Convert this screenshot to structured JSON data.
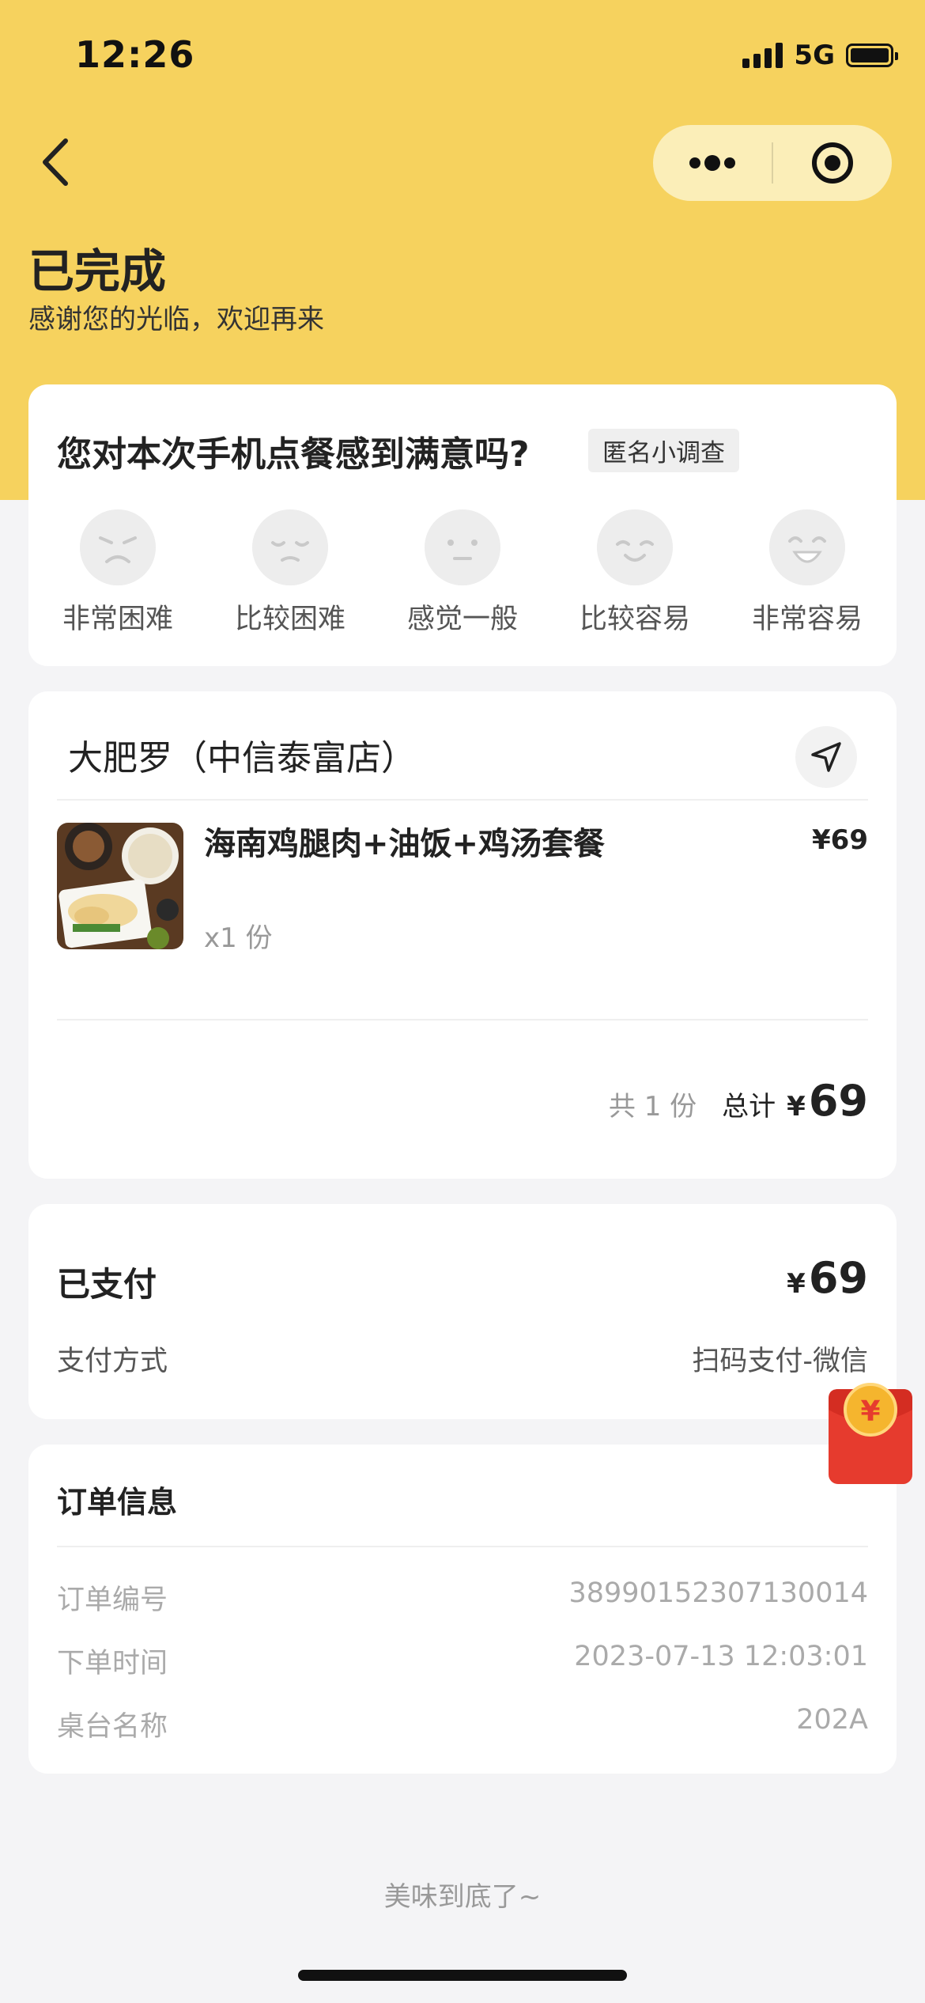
{
  "status_bar": {
    "time": "12:26",
    "network": "5G"
  },
  "header": {
    "title": "已完成",
    "subtitle": "感谢您的光临，欢迎再来"
  },
  "survey": {
    "question": "您对本次手机点餐感到满意吗?",
    "tag": "匿名小调查",
    "options": [
      {
        "label": "非常困难",
        "icon": "very-sad-face-icon"
      },
      {
        "label": "比较困难",
        "icon": "sad-face-icon"
      },
      {
        "label": "感觉一般",
        "icon": "neutral-face-icon"
      },
      {
        "label": "比较容易",
        "icon": "happy-face-icon"
      },
      {
        "label": "非常容易",
        "icon": "very-happy-face-icon"
      }
    ]
  },
  "order": {
    "store_name": "大肥罗（中信泰富店）",
    "item": {
      "name": "海南鸡腿肉+油饭+鸡汤套餐",
      "price": "¥69",
      "quantity": "x1 份"
    },
    "summary": {
      "count": "共 1 份",
      "total_label": "总计",
      "currency": "¥",
      "total": "69"
    }
  },
  "payment": {
    "title": "已支付",
    "currency": "¥",
    "amount": "69",
    "method_label": "支付方式",
    "method_value": "扫码支付-微信"
  },
  "order_info": {
    "title": "订单信息",
    "rows": [
      {
        "label": "订单编号",
        "value": "38990152307130014"
      },
      {
        "label": "下单时间",
        "value": "2023-07-13 12:03:01"
      },
      {
        "label": "桌台名称",
        "value": "202A"
      }
    ]
  },
  "footer": {
    "text": "美味到底了~"
  },
  "colors": {
    "header_bg": "#f6d25e",
    "red_packet": "#e63b2e"
  }
}
